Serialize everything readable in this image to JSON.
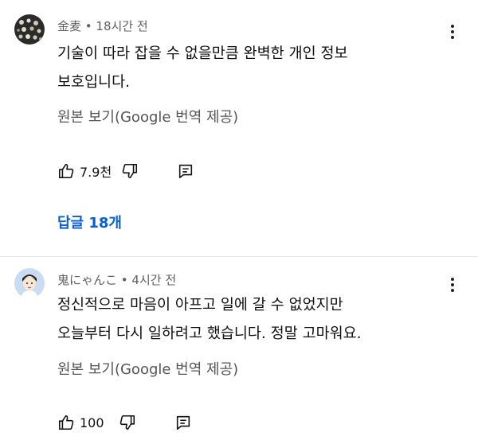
{
  "comments": [
    {
      "author": "金麦",
      "time": "18시간 전",
      "text_lines": [
        "기술이 따라 잡을 수 없을만큼 완벽한 개인 정보",
        "보호입니다."
      ],
      "translate_label": "원본 보기(Google 번역 제공)",
      "likes": "7.9천",
      "replies_label": "답글 18개"
    },
    {
      "author": "鬼にゃんこ",
      "time": "4시간 전",
      "text_lines": [
        "정신적으로 마음이 아프고 일에 갈 수 없었지만",
        "오늘부터 다시 일하려고 했습니다. 정말 고마워요."
      ],
      "translate_label": "원본 보기(Google 번역 제공)",
      "likes": "100"
    }
  ],
  "meta_separator": " • ",
  "colors": {
    "link": "#065fd4",
    "secondary_text": "#606060"
  }
}
